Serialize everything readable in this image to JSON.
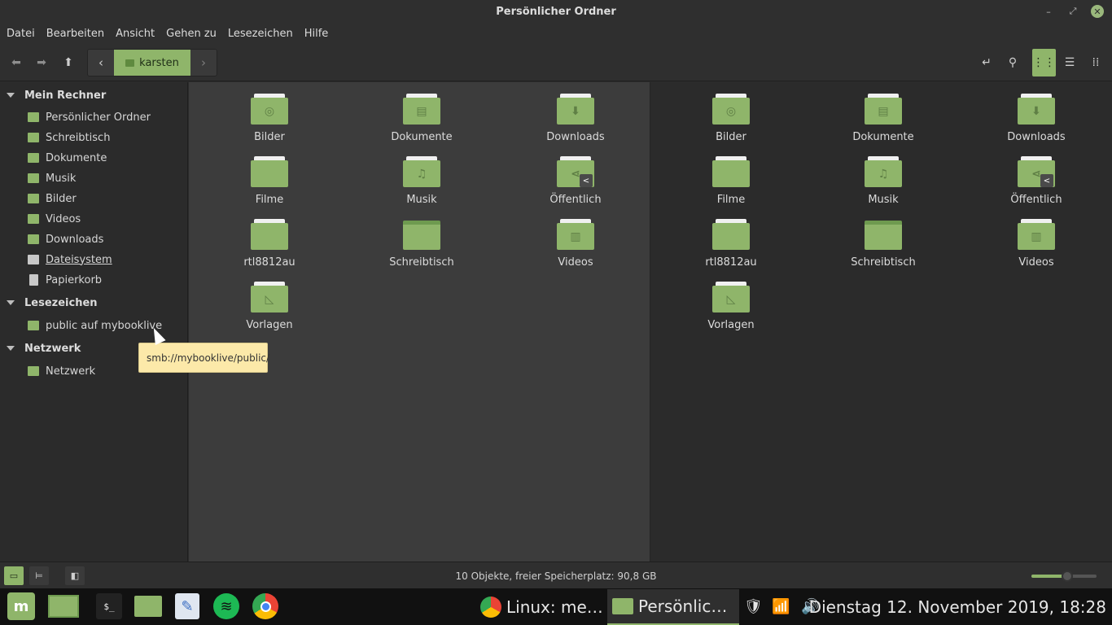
{
  "window": {
    "title": "Persönlicher Ordner",
    "minimize_icon": "minimize-icon",
    "maximize_icon": "maximize-icon",
    "close_icon": "close-icon"
  },
  "menu": [
    "Datei",
    "Bearbeiten",
    "Ansicht",
    "Gehen zu",
    "Lesezeichen",
    "Hilfe"
  ],
  "toolbar": {
    "breadcrumb": "karsten",
    "accent": "#8fb56a"
  },
  "sidebar": {
    "sections": [
      {
        "title": "Mein Rechner",
        "items": [
          "Persönlicher Ordner",
          "Schreibtisch",
          "Dokumente",
          "Musik",
          "Bilder",
          "Videos",
          "Downloads",
          "Dateisystem",
          "Papierkorb"
        ]
      },
      {
        "title": "Lesezeichen",
        "items": [
          "public auf mybooklive"
        ]
      },
      {
        "title": "Netzwerk",
        "items": [
          "Netzwerk"
        ]
      }
    ]
  },
  "tooltip": "smb://mybooklive/public/",
  "left_pane": {
    "files": [
      {
        "name": "Bilder",
        "icon": "camera-icon"
      },
      {
        "name": "Dokumente",
        "icon": "document-icon"
      },
      {
        "name": "Downloads",
        "icon": "download-arrow-icon"
      },
      {
        "name": "Filme",
        "icon": "folder-icon"
      },
      {
        "name": "Musik",
        "icon": "music-note-icon"
      },
      {
        "name": "Öffentlich",
        "icon": "share-icon"
      },
      {
        "name": "rtl8812au",
        "icon": "folder-icon"
      },
      {
        "name": "Schreibtisch",
        "icon": "desktop-folder-icon"
      },
      {
        "name": "Videos",
        "icon": "film-icon"
      },
      {
        "name": "Vorlagen",
        "icon": "template-icon"
      }
    ]
  },
  "right_pane": {
    "files": [
      {
        "name": "Bilder",
        "icon": "camera-icon"
      },
      {
        "name": "Dokumente",
        "icon": "document-icon"
      },
      {
        "name": "Downloads",
        "icon": "download-arrow-icon"
      },
      {
        "name": "Filme",
        "icon": "folder-icon"
      },
      {
        "name": "Musik",
        "icon": "music-note-icon"
      },
      {
        "name": "Öffentlich",
        "icon": "share-icon"
      },
      {
        "name": "rtl8812au",
        "icon": "folder-icon"
      },
      {
        "name": "Schreibtisch",
        "icon": "desktop-folder-icon"
      },
      {
        "name": "Videos",
        "icon": "film-icon"
      },
      {
        "name": "Vorlagen",
        "icon": "template-icon"
      }
    ]
  },
  "status": {
    "text": "10 Objekte, freier Speicherplatz: 90,8 GB",
    "zoom_level_fraction": 0.55
  },
  "taskbar": {
    "windows": [
      {
        "label": "Linux: me…",
        "icon": "chrome-icon"
      },
      {
        "label": "Persönlic…",
        "icon": "folder-icon"
      }
    ],
    "clock": "Dienstag 12. November 2019, 18:28"
  }
}
